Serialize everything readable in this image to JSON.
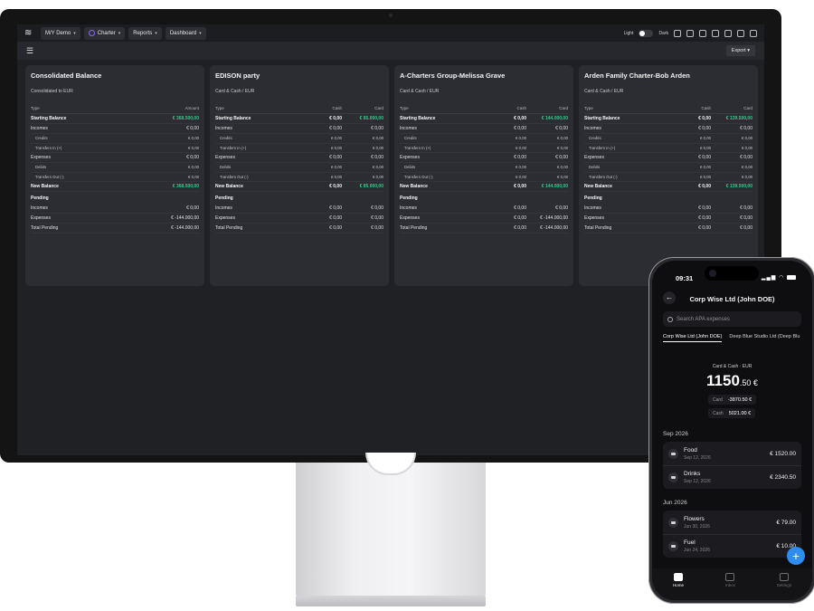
{
  "topbar": {
    "vessel_label": "M/Y Demo",
    "charter_label": "Charter",
    "reports_label": "Reports",
    "dashboard_label": "Dashboard",
    "theme_light": "Light",
    "theme_dark": "Dark"
  },
  "subbar": {
    "export_label": "Export"
  },
  "cards": [
    {
      "title": "Consolidated Balance",
      "subtitle": "Consolidated to EUR",
      "col_type": "Type",
      "col_a": "Amount",
      "rows": {
        "starting": {
          "label": "Starting Balance",
          "a": "€ 368.500,00"
        },
        "incomes": {
          "label": "Incomes",
          "a": "€ 0,00"
        },
        "credits": {
          "label": "Credits",
          "a": "€ 0,00"
        },
        "transfers_in": {
          "label": "Transfers In (+)",
          "a": "€ 0,00"
        },
        "expenses": {
          "label": "Expenses",
          "a": "€ 0,00"
        },
        "debits": {
          "label": "Debits",
          "a": "€ 0,00"
        },
        "transfers_out": {
          "label": "Transfers Out (-)",
          "a": "€ 0,00"
        },
        "new_balance": {
          "label": "New Balance",
          "a": "€ 368.500,00"
        },
        "pending": {
          "label": "Pending"
        },
        "p_incomes": {
          "label": "Incomes",
          "a": "€ 0,00"
        },
        "p_expenses": {
          "label": "Expenses",
          "a": "€ -144.000,00"
        },
        "p_total": {
          "label": "Total Pending",
          "a": "€ -144.000,00"
        }
      }
    },
    {
      "title": "EDISON party",
      "subtitle": "Card & Cash / EUR",
      "col_type": "Type",
      "col_a": "Cash",
      "col_b": "Card",
      "rows": {
        "starting": {
          "label": "Starting Balance",
          "a": "€ 0,00",
          "b": "€ 85.000,00"
        },
        "incomes": {
          "label": "Incomes",
          "a": "€ 0,00",
          "b": "€ 0,00"
        },
        "credits": {
          "label": "Credits",
          "a": "€ 0,00",
          "b": "€ 0,00"
        },
        "transfers_in": {
          "label": "Transfers In (+)",
          "a": "€ 0,00",
          "b": "€ 0,00"
        },
        "expenses": {
          "label": "Expenses",
          "a": "€ 0,00",
          "b": "€ 0,00"
        },
        "debits": {
          "label": "Debits",
          "a": "€ 0,00",
          "b": "€ 0,00"
        },
        "transfers_out": {
          "label": "Transfers Out (-)",
          "a": "€ 0,00",
          "b": "€ 0,00"
        },
        "new_balance": {
          "label": "New Balance",
          "a": "€ 0,00",
          "b": "€ 85.000,00"
        },
        "pending": {
          "label": "Pending"
        },
        "p_incomes": {
          "label": "Incomes",
          "a": "€ 0,00",
          "b": "€ 0,00"
        },
        "p_expenses": {
          "label": "Expenses",
          "a": "€ 0,00",
          "b": "€ 0,00"
        },
        "p_total": {
          "label": "Total Pending",
          "a": "€ 0,00",
          "b": "€ 0,00"
        }
      }
    },
    {
      "title": "A-Charters Group-Melissa Grave",
      "subtitle": "Card & Cash / EUR",
      "col_type": "Type",
      "col_a": "Cash",
      "col_b": "Card",
      "rows": {
        "starting": {
          "label": "Starting Balance",
          "a": "€ 0,00",
          "b": "€ 144.000,00"
        },
        "incomes": {
          "label": "Incomes",
          "a": "€ 0,00",
          "b": "€ 0,00"
        },
        "credits": {
          "label": "Credits",
          "a": "€ 0,00",
          "b": "€ 0,00"
        },
        "transfers_in": {
          "label": "Transfers In (+)",
          "a": "€ 0,00",
          "b": "€ 0,00"
        },
        "expenses": {
          "label": "Expenses",
          "a": "€ 0,00",
          "b": "€ 0,00"
        },
        "debits": {
          "label": "Debits",
          "a": "€ 0,00",
          "b": "€ 0,00"
        },
        "transfers_out": {
          "label": "Transfers Out (-)",
          "a": "€ 0,00",
          "b": "€ 0,00"
        },
        "new_balance": {
          "label": "New Balance",
          "a": "€ 0,00",
          "b": "€ 144.000,00"
        },
        "pending": {
          "label": "Pending"
        },
        "p_incomes": {
          "label": "Incomes",
          "a": "€ 0,00",
          "b": "€ 0,00"
        },
        "p_expenses": {
          "label": "Expenses",
          "a": "€ 0,00",
          "b": "€ -144.000,00"
        },
        "p_total": {
          "label": "Total Pending",
          "a": "€ 0,00",
          "b": "€ -144.000,00"
        }
      }
    },
    {
      "title": "Arden Family Charter-Bob Arden",
      "subtitle": "Card & Cash / EUR",
      "col_type": "Type",
      "col_a": "Cash",
      "col_b": "Card",
      "rows": {
        "starting": {
          "label": "Starting Balance",
          "a": "€ 0,00",
          "b": "€ 139.500,00"
        },
        "incomes": {
          "label": "Incomes",
          "a": "€ 0,00",
          "b": "€ 0,00"
        },
        "credits": {
          "label": "Credits",
          "a": "€ 0,00",
          "b": "€ 0,00"
        },
        "transfers_in": {
          "label": "Transfers In (+)",
          "a": "€ 0,00",
          "b": "€ 0,00"
        },
        "expenses": {
          "label": "Expenses",
          "a": "€ 0,00",
          "b": "€ 0,00"
        },
        "debits": {
          "label": "Debits",
          "a": "€ 0,00",
          "b": "€ 0,00"
        },
        "transfers_out": {
          "label": "Transfers Out (-)",
          "a": "€ 0,00",
          "b": "€ 0,00"
        },
        "new_balance": {
          "label": "New Balance",
          "a": "€ 0,00",
          "b": "€ 139.500,00"
        },
        "pending": {
          "label": "Pending"
        },
        "p_incomes": {
          "label": "Incomes",
          "a": "€ 0,00",
          "b": "€ 0,00"
        },
        "p_expenses": {
          "label": "Expenses",
          "a": "€ 0,00",
          "b": "€ 0,00"
        },
        "p_total": {
          "label": "Total Pending",
          "a": "€ 0,00",
          "b": "€ 0,00"
        }
      }
    }
  ],
  "phone": {
    "time": "09:31",
    "title": "Corp Wise Ltd (John  DOE)",
    "search_placeholder": "Search APA expenses",
    "tabs": [
      "Corp Wise Ltd (John  DOE)",
      "Deep Blue Studio Ltd (Deep Blu"
    ],
    "balance_label": "Card & Cash · EUR",
    "balance_int": "1150",
    "balance_dec": ".50 €",
    "card_label": "Card",
    "card_value": "-3870.50 €",
    "cash_label": "Cash",
    "cash_value": "5021.00 €",
    "sections": [
      {
        "title": "Sep 2026",
        "items": [
          {
            "name": "Food",
            "date": "Sep 12, 2026",
            "amount": "€ 1520.00"
          },
          {
            "name": "Drinks",
            "date": "Sep 12, 2026",
            "amount": "€ 2340.50"
          }
        ]
      },
      {
        "title": "Jun 2026",
        "items": [
          {
            "name": "Flowers",
            "date": "Jun 30, 2026",
            "amount": "€ 79.00"
          },
          {
            "name": "Fuel",
            "date": "Jun 24, 2026",
            "amount": "€ 10.00"
          }
        ]
      }
    ],
    "fab_label": "+",
    "nav": {
      "home": "Home",
      "inbox": "Inbox",
      "settings": "Settings"
    }
  },
  "colors": {
    "accent_green": "#31c98a",
    "fab_blue": "#2d8cf0"
  }
}
